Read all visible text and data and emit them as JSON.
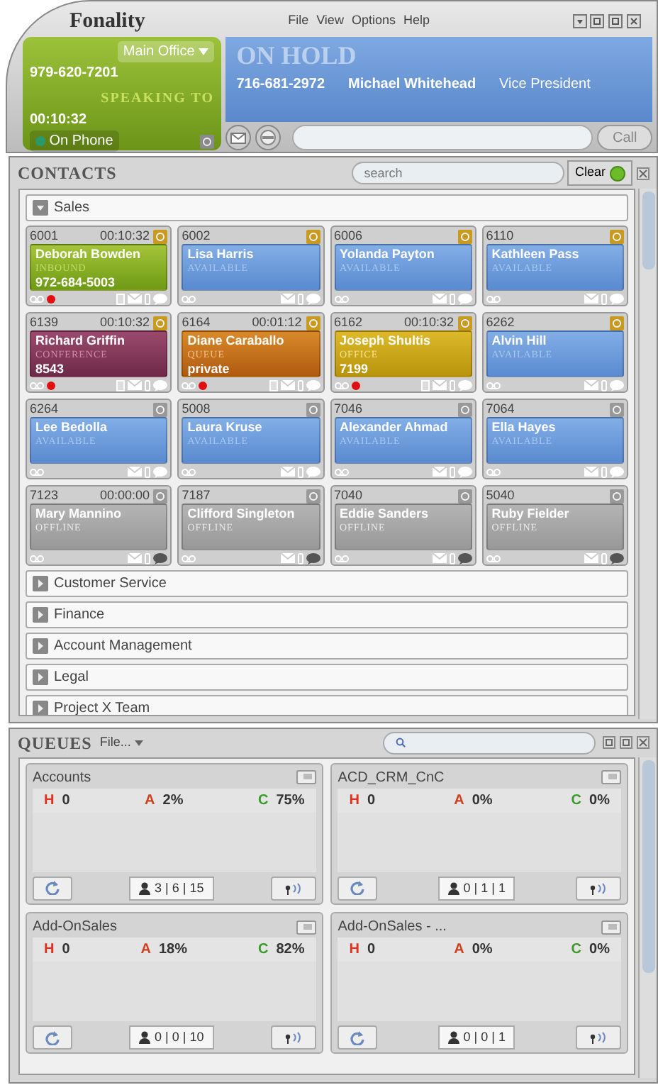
{
  "app": {
    "logo": "Fonality",
    "menu": [
      "File",
      "View",
      "Options",
      "Help"
    ]
  },
  "line_panel": {
    "location": "Main Office",
    "number": "979-620-7201",
    "status_label": "SPEAKING TO",
    "timer": "00:10:32",
    "presence": "On Phone"
  },
  "call_panel": {
    "state": "ON HOLD",
    "number": "716-681-2972",
    "name": "Michael Whitehead",
    "title": "Vice President"
  },
  "dialer": {
    "button": "Call"
  },
  "contacts": {
    "title": "CONTACTS",
    "search_placeholder": "search",
    "clear": "Clear",
    "groups": [
      {
        "name": "Sales",
        "expanded": true,
        "cards": [
          {
            "ext": "6001",
            "timer": "00:10:32",
            "name": "Deborah Bowden",
            "status": "INBOUND",
            "detail": "972-684-5003",
            "kind": "inbound",
            "queue_login": true,
            "recording": true
          },
          {
            "ext": "6002",
            "name": "Lisa Harris",
            "status": "AVAILABLE",
            "kind": "available",
            "queue_login": true,
            "recording": false
          },
          {
            "ext": "6006",
            "name": "Yolanda Payton",
            "status": "AVAILABLE",
            "kind": "available",
            "queue_login": true,
            "recording": false
          },
          {
            "ext": "6110",
            "name": "Kathleen Pass",
            "status": "AVAILABLE",
            "kind": "available",
            "queue_login": true,
            "recording": false
          },
          {
            "ext": "6139",
            "timer": "00:10:32",
            "name": "Richard Griffin",
            "status": "CONFERENCE",
            "detail": "8543",
            "kind": "conference",
            "queue_login": true,
            "recording": true
          },
          {
            "ext": "6164",
            "timer": "00:01:12",
            "name": "Diane Caraballo",
            "status": "QUEUE",
            "detail": "private",
            "kind": "queue",
            "queue_login": true,
            "recording": true
          },
          {
            "ext": "6162",
            "timer": "00:10:32",
            "name": "Joseph Shultis",
            "status": "OFFICE",
            "detail": "7199",
            "kind": "office",
            "queue_login": true,
            "recording": true
          },
          {
            "ext": "6262",
            "name": "Alvin Hill",
            "status": "AVAILABLE",
            "kind": "available",
            "queue_login": true,
            "recording": false
          },
          {
            "ext": "6264",
            "name": "Lee Bedolla",
            "status": "AVAILABLE",
            "kind": "available",
            "queue_login": false,
            "recording": false
          },
          {
            "ext": "5008",
            "name": "Laura Kruse",
            "status": "AVAILABLE",
            "kind": "available",
            "queue_login": false,
            "recording": false
          },
          {
            "ext": "7046",
            "name": "Alexander Ahmad",
            "status": "AVAILABLE",
            "kind": "available",
            "queue_login": false,
            "recording": false
          },
          {
            "ext": "7064",
            "name": "Ella Hayes",
            "status": "AVAILABLE",
            "kind": "available",
            "queue_login": false,
            "recording": false
          },
          {
            "ext": "7123",
            "timer": "00:00:00",
            "name": "Mary Mannino",
            "status": "OFFLINE",
            "kind": "offline",
            "queue_login": false,
            "recording": false
          },
          {
            "ext": "7187",
            "name": "Clifford Singleton",
            "status": "OFFLINE",
            "kind": "offline",
            "queue_login": false,
            "recording": false
          },
          {
            "ext": "7040",
            "name": "Eddie Sanders",
            "status": "OFFLINE",
            "kind": "offline",
            "queue_login": false,
            "recording": false
          },
          {
            "ext": "5040",
            "name": "Ruby Fielder",
            "status": "OFFLINE",
            "kind": "offline",
            "queue_login": false,
            "recording": false
          }
        ]
      },
      {
        "name": "Customer Service",
        "expanded": false
      },
      {
        "name": "Finance",
        "expanded": false
      },
      {
        "name": "Account Management",
        "expanded": false
      },
      {
        "name": "Legal",
        "expanded": false
      },
      {
        "name": "Project X Team",
        "expanded": false
      }
    ]
  },
  "queues": {
    "title": "QUEUES",
    "menu": "File...",
    "items": [
      {
        "name": "Accounts",
        "stats": [
          {
            "label": "H",
            "value": "0",
            "color": "#e0301e"
          },
          {
            "label": "A",
            "value": "2%",
            "color": "#d04020"
          },
          {
            "label": "C",
            "value": "75%",
            "color": "#3a9a2a"
          }
        ],
        "agents": "3 | 6 | 15"
      },
      {
        "name": "ACD_CRM_CnC",
        "stats": [
          {
            "label": "H",
            "value": "0",
            "color": "#e0301e"
          },
          {
            "label": "A",
            "value": "0%",
            "color": "#d04020"
          },
          {
            "label": "C",
            "value": "0%",
            "color": "#3a9a2a"
          }
        ],
        "agents": "0 | 1 | 1"
      },
      {
        "name": "Add-OnSales",
        "stats": [
          {
            "label": "H",
            "value": "0",
            "color": "#e0301e"
          },
          {
            "label": "A",
            "value": "18%",
            "color": "#d04020"
          },
          {
            "label": "C",
            "value": "82%",
            "color": "#3a9a2a"
          }
        ],
        "agents": "0 | 0 | 10"
      },
      {
        "name": "Add-OnSales - ...",
        "stats": [
          {
            "label": "H",
            "value": "0",
            "color": "#e0301e"
          },
          {
            "label": "A",
            "value": "0%",
            "color": "#d04020"
          },
          {
            "label": "C",
            "value": "0%",
            "color": "#3a9a2a"
          }
        ],
        "agents": "0 | 0 | 1"
      }
    ]
  }
}
